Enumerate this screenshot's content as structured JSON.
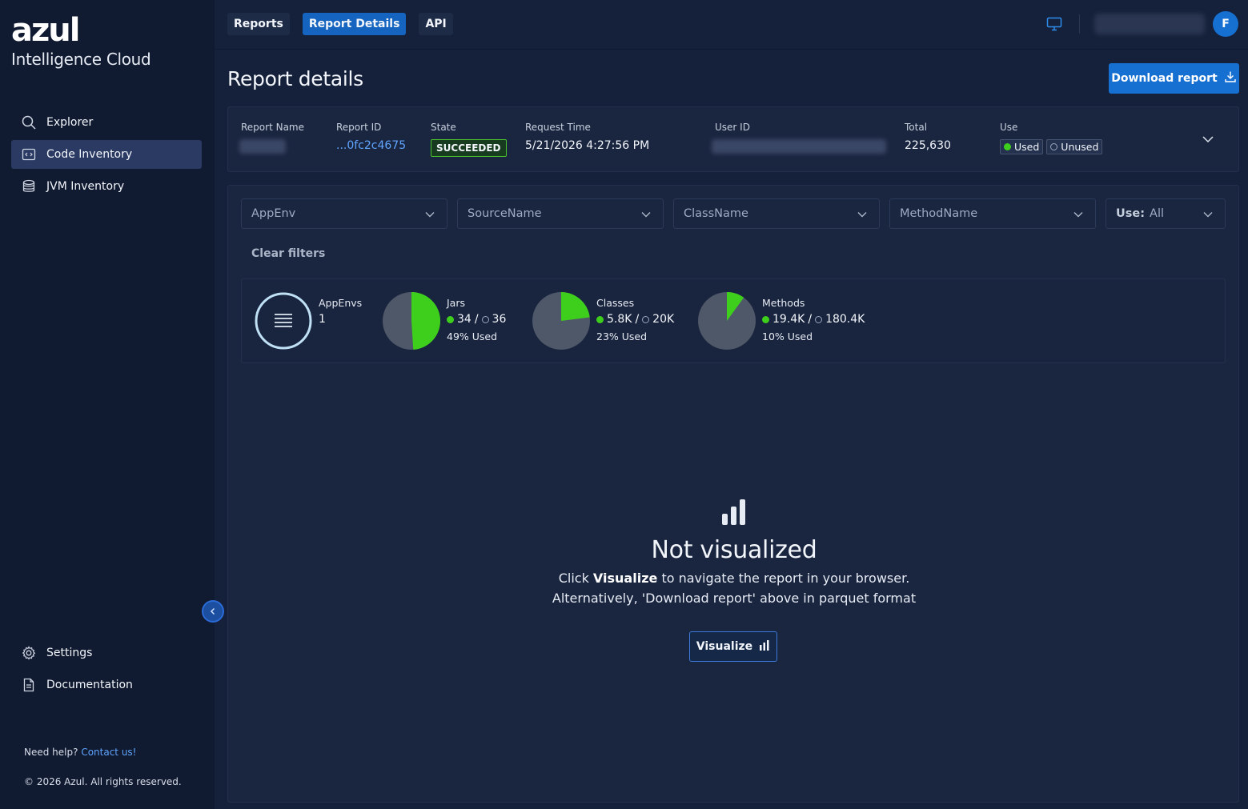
{
  "brand": {
    "logo": "azul",
    "product": "Intelligence Cloud"
  },
  "sidebar": {
    "items": [
      {
        "label": "Explorer",
        "icon": "search-icon"
      },
      {
        "label": "Code Inventory",
        "icon": "code-window-icon",
        "active": true
      },
      {
        "label": "JVM Inventory",
        "icon": "database-icon"
      }
    ],
    "bottom_items": [
      {
        "label": "Settings",
        "icon": "gear-icon"
      },
      {
        "label": "Documentation",
        "icon": "document-icon"
      }
    ],
    "help_text": "Need help?",
    "help_link": "Contact us!",
    "copyright": "© 2026 Azul. All rights reserved."
  },
  "topbar": {
    "tabs": [
      {
        "label": "Reports"
      },
      {
        "label": "Report Details",
        "active": true
      },
      {
        "label": "API"
      }
    ],
    "avatar_initial": "F"
  },
  "header": {
    "title": "Report details",
    "download_label": "Download report"
  },
  "summary": {
    "report_name_label": "Report Name",
    "report_id_label": "Report ID",
    "report_id": "...0fc2c4675",
    "state_label": "State",
    "state": "SUCCEEDED",
    "request_time_label": "Request Time",
    "request_time": "5/21/2026 4:27:56 PM",
    "user_id_label": "User ID",
    "total_label": "Total",
    "total": "225,630",
    "use_label": "Use",
    "use_used": "Used",
    "use_unused": "Unused"
  },
  "filters": {
    "appenv": "AppEnv",
    "source": "SourceName",
    "class": "ClassName",
    "method": "MethodName",
    "use_prefix": "Use:",
    "use_value": "All",
    "clear": "Clear filters"
  },
  "stats": {
    "appenvs": {
      "label": "AppEnvs",
      "value": "1"
    },
    "jars": {
      "label": "Jars",
      "used": "34",
      "total": "36",
      "pct_text": "49% Used",
      "fraction": 0.49
    },
    "classes": {
      "label": "Classes",
      "used": "5.8K",
      "total": "20K",
      "pct_text": "23% Used",
      "fraction": 0.23
    },
    "methods": {
      "label": "Methods",
      "used": "19.4K",
      "total": "180.4K",
      "pct_text": "10% Used",
      "fraction": 0.1
    },
    "colors": {
      "used": "#3ecf1c",
      "unused": "#4e5869"
    }
  },
  "empty_state": {
    "title": "Not visualized",
    "line1_prefix": "Click",
    "line1_bold": "Visualize",
    "line1_suffix": "to navigate the report in your browser.",
    "line2": "Alternatively, 'Download report' above in parquet format",
    "button": "Visualize"
  },
  "separator": "/"
}
